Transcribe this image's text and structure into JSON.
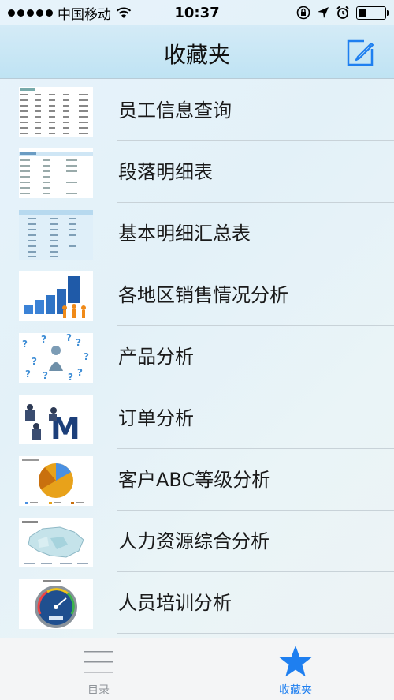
{
  "status_bar": {
    "carrier": "中国移动",
    "time": "10:37"
  },
  "nav": {
    "title": "收藏夹"
  },
  "items": [
    {
      "label": "员工信息查询",
      "thumb": "table-icon"
    },
    {
      "label": "段落明细表",
      "thumb": "report-icon"
    },
    {
      "label": "基本明细汇总表",
      "thumb": "table-blue-icon"
    },
    {
      "label": "各地区销售情况分析",
      "thumb": "bar-chart-figures-icon"
    },
    {
      "label": "产品分析",
      "thumb": "question-marks-figure-icon"
    },
    {
      "label": "订单分析",
      "thumb": "building-figures-icon"
    },
    {
      "label": "客户ABC等级分析",
      "thumb": "pie-chart-icon"
    },
    {
      "label": "人力资源综合分析",
      "thumb": "map-icon"
    },
    {
      "label": "人员培训分析",
      "thumb": "gauge-icon"
    }
  ],
  "tabs": [
    {
      "label": "目录",
      "icon": "list-icon",
      "active": false
    },
    {
      "label": "收藏夹",
      "icon": "star-icon",
      "active": true
    }
  ],
  "colors": {
    "accent": "#1e7ff0",
    "nav_bg": "#bfe3f3"
  }
}
